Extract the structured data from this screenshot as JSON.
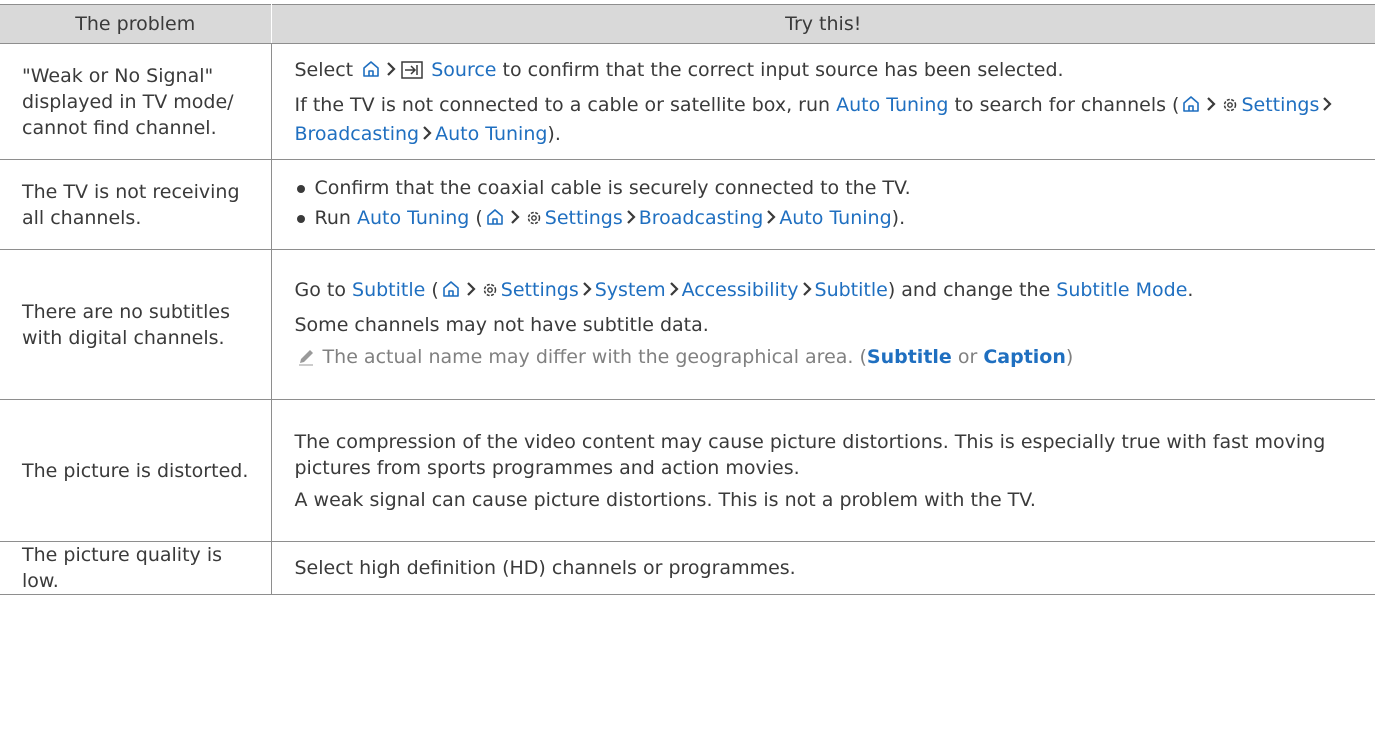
{
  "header": {
    "col1": "The problem",
    "col2": "Try this!"
  },
  "rows": [
    {
      "problem": "\"Weak or No Signal\" displayed in TV mode/ cannot find channel.",
      "p1_select": "Select",
      "p1_source": "Source",
      "p1_rest": "to confirm that the correct input source has been selected.",
      "p2_a": "If the TV is not connected to a cable or satellite box, run",
      "p2_auto": "Auto Tuning",
      "p2_b": "to search for channels (",
      "p2_settings": "Settings",
      "p2_broadcasting": "Broadcasting",
      "p2_auto2": "Auto Tuning",
      "p2_end": ")."
    },
    {
      "problem": "The TV is not receiving all channels.",
      "b1": "Confirm that the coaxial cable is securely connected to the TV.",
      "b2_run": "Run",
      "b2_auto": "Auto Tuning",
      "b2_open": "(",
      "b2_settings": "Settings",
      "b2_broadcasting": "Broadcasting",
      "b2_auto2": "Auto Tuning",
      "b2_end": ")."
    },
    {
      "problem": "There are no subtitles with digital channels.",
      "p1_goto": "Go to",
      "p1_subtitle": "Subtitle",
      "p1_open": "(",
      "p1_settings": "Settings",
      "p1_system": "System",
      "p1_accessibility": "Accessibility",
      "p1_subtitle2": "Subtitle",
      "p1_and": ") and change the",
      "p1_mode": "Subtitle Mode",
      "p1_dot": ".",
      "p2": "Some channels may not have subtitle data.",
      "note_a": "The actual name may differ with the geographical area. (",
      "note_subtitle": "Subtitle",
      "note_or": "or",
      "note_caption": "Caption",
      "note_end": ")"
    },
    {
      "problem": "The picture is distorted.",
      "p1": "The compression of the video content may cause picture distortions. This is especially true with fast moving pictures from sports programmes and action movies.",
      "p2": "A weak signal can cause picture distortions. This is not a problem with the TV."
    },
    {
      "problem": "The picture quality is low.",
      "p1": "Select high definition (HD) channels or programmes."
    }
  ],
  "icons": {
    "home": "home-icon",
    "source": "source-icon",
    "settings": "gear-icon",
    "chevron": "chevron-right-icon",
    "note": "pencil-icon"
  },
  "colors": {
    "header_bg": "#d9d9d9",
    "link": "#1f6fc0",
    "text": "#3a3a3a",
    "border": "#8e8e8e"
  }
}
